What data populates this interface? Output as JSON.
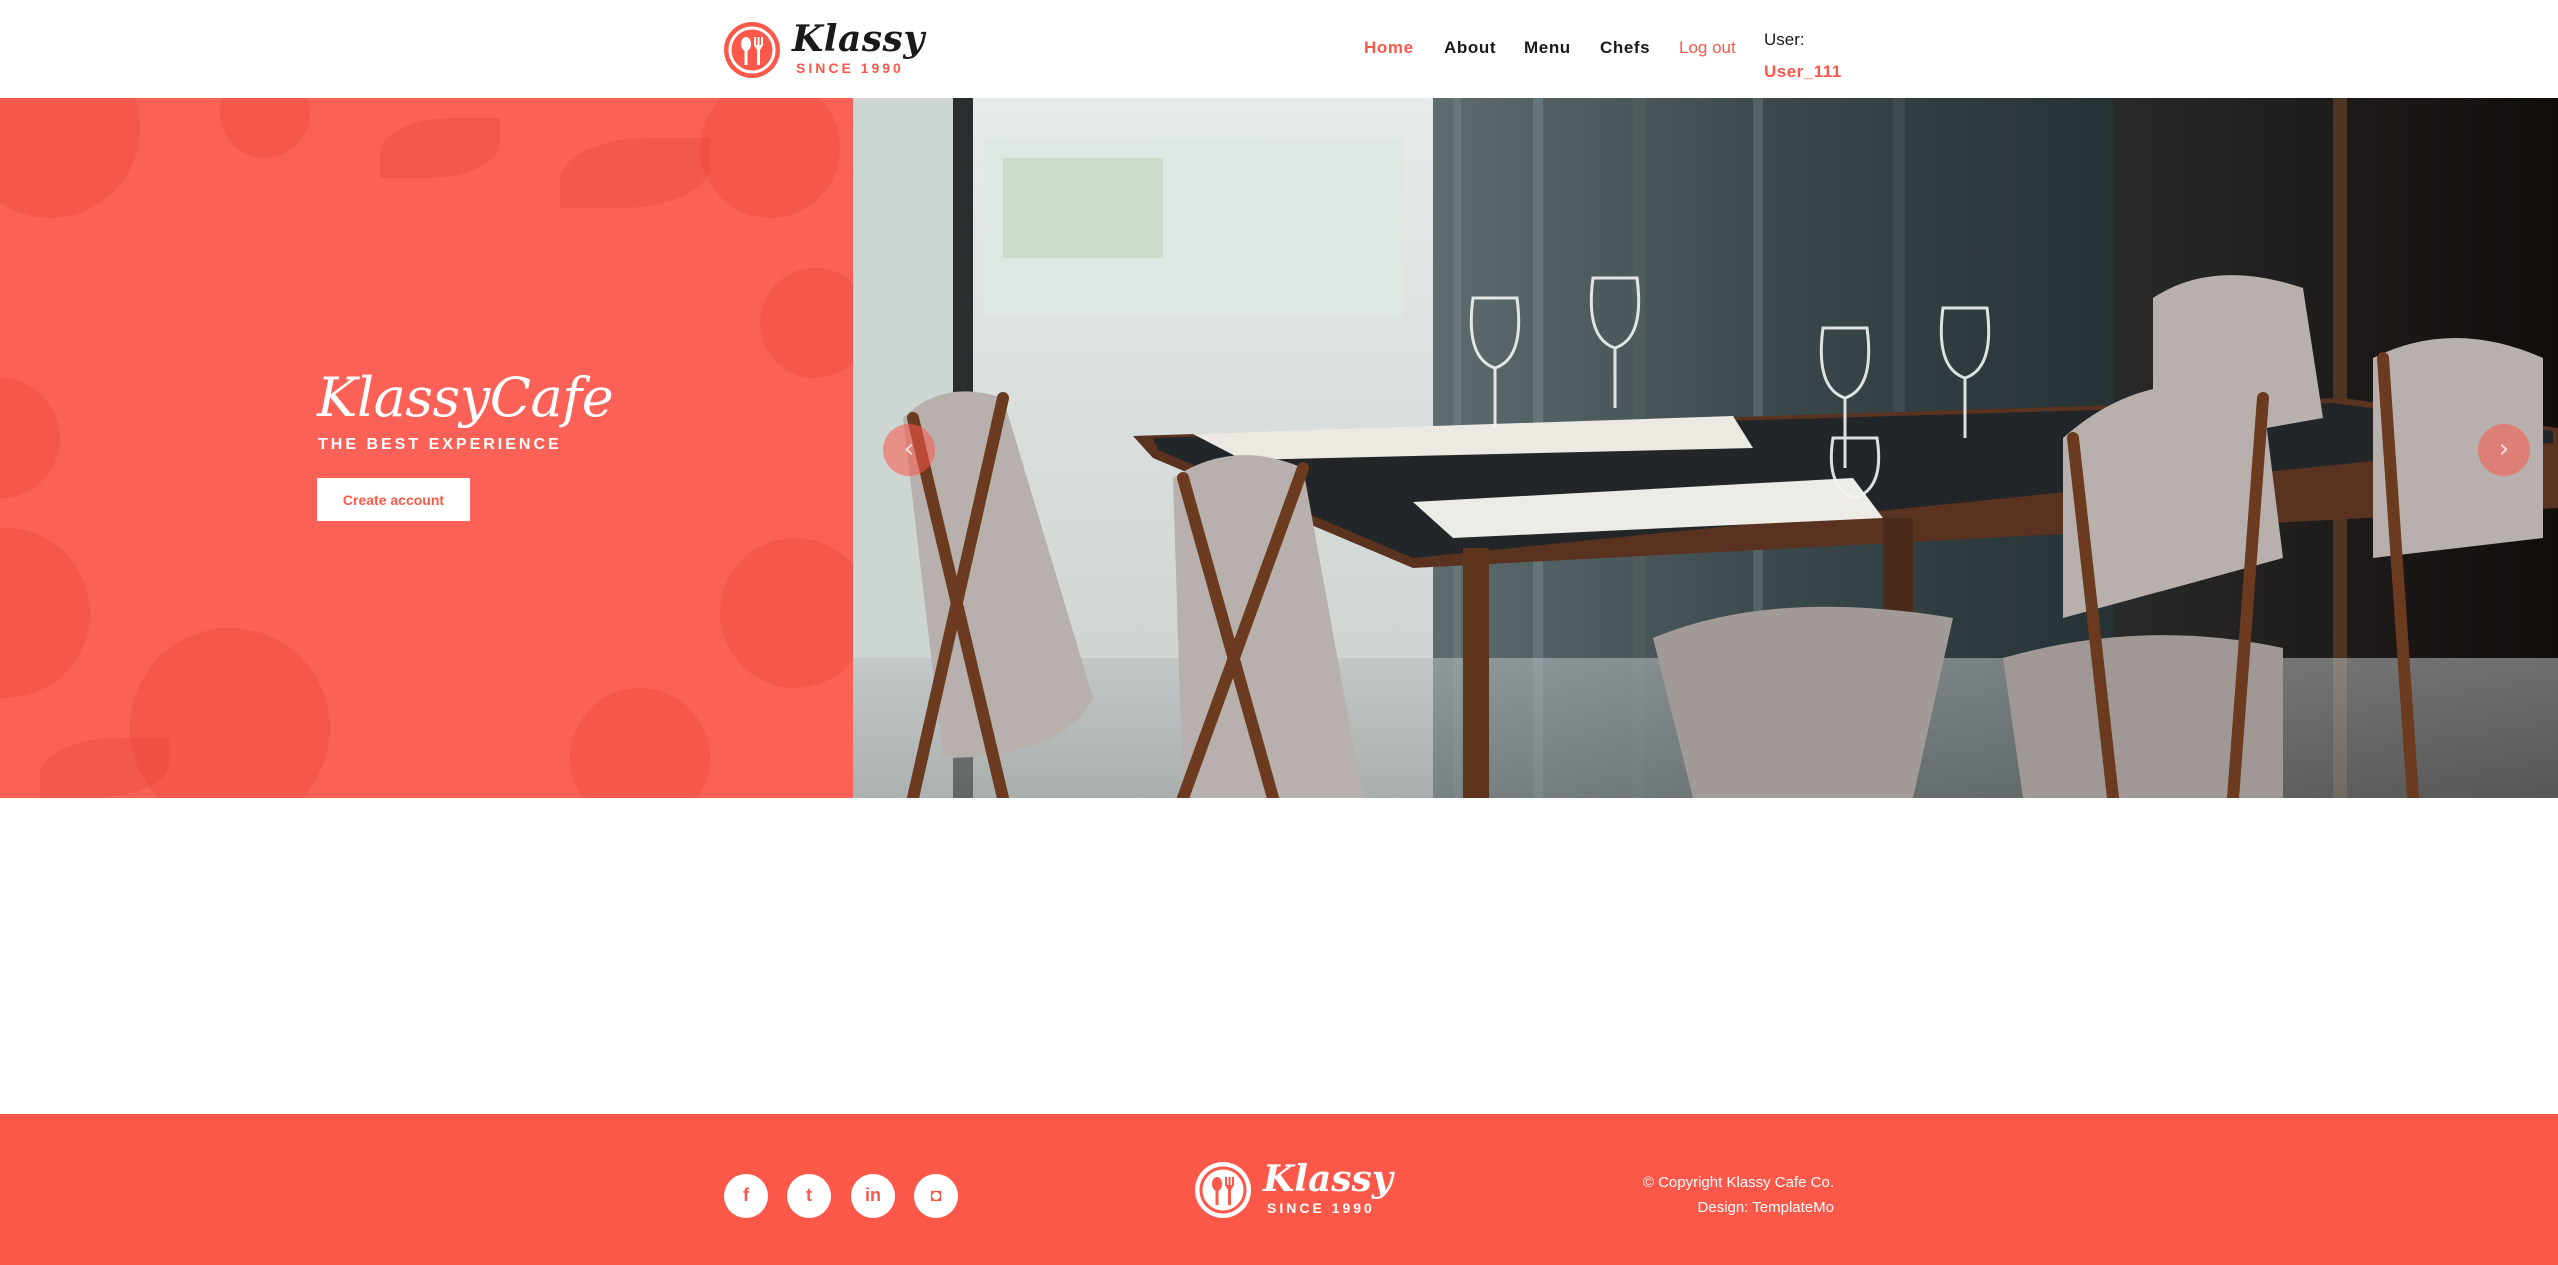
{
  "brand": {
    "name": "Klassy",
    "since": "SINCE 1990"
  },
  "nav": {
    "items": [
      {
        "label": "Home",
        "active": true
      },
      {
        "label": "About",
        "active": false
      },
      {
        "label": "Menu",
        "active": false
      },
      {
        "label": "Chefs",
        "active": false
      }
    ],
    "logout": "Log out",
    "user_label": "User:",
    "user_name": "User_111"
  },
  "hero": {
    "title": "KlassyCafe",
    "subtitle": "THE BEST EXPERIENCE",
    "cta": "Create account",
    "prev_icon": "chevron-left-icon",
    "next_icon": "chevron-right-icon"
  },
  "footer": {
    "social": [
      {
        "icon": "facebook-icon",
        "glyph": "f"
      },
      {
        "icon": "twitter-icon",
        "glyph": "t"
      },
      {
        "icon": "linkedin-icon",
        "glyph": "in"
      },
      {
        "icon": "instagram-icon",
        "glyph": "◘"
      }
    ],
    "copyright": "© Copyright Klassy Cafe Co.",
    "design": "Design: TemplateMo"
  },
  "colors": {
    "accent": "#fb5849",
    "hero_panel": "#fb6157",
    "text_dark": "#1a1a1a",
    "white": "#ffffff"
  }
}
